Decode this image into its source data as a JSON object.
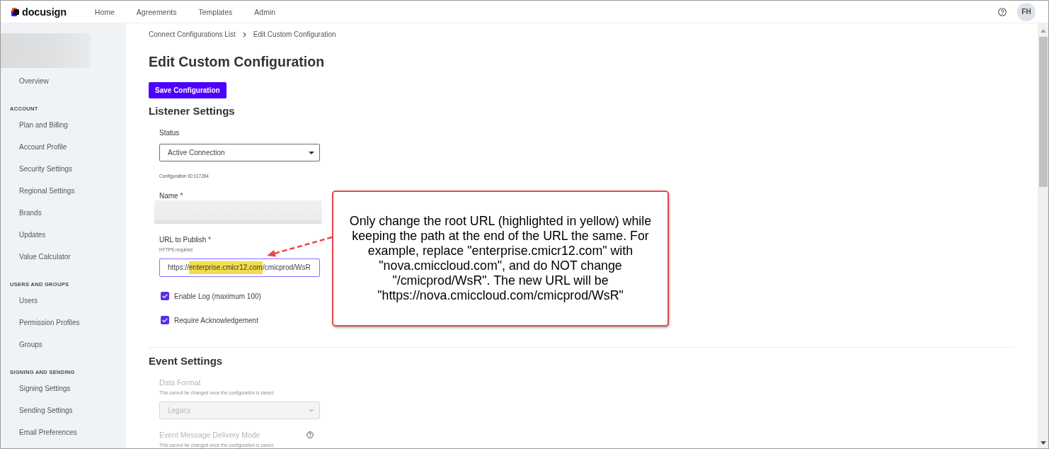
{
  "header": {
    "logo": "docusign",
    "nav": [
      "Home",
      "Agreements",
      "Templates",
      "Admin"
    ],
    "avatar": "FH"
  },
  "sidebar": {
    "overview": "Overview",
    "sections": [
      {
        "heading": "ACCOUNT",
        "items": [
          "Plan and Billing",
          "Account Profile",
          "Security Settings",
          "Regional Settings",
          "Brands",
          "Updates",
          "Value Calculator"
        ]
      },
      {
        "heading": "USERS AND GROUPS",
        "items": [
          "Users",
          "Permission Profiles",
          "Groups"
        ]
      },
      {
        "heading": "SIGNING AND SENDING",
        "items": [
          "Signing Settings",
          "Sending Settings",
          "Email Preferences"
        ]
      }
    ]
  },
  "breadcrumb": [
    "Connect Configurations List",
    "Edit Custom Configuration"
  ],
  "page_title": "Edit Custom Configuration",
  "save_button": "Save Configuration",
  "listener_settings": {
    "heading": "Listener Settings",
    "status": {
      "label": "Status",
      "value": "Active Connection",
      "focused": false
    },
    "configuration_id": "Configuration ID:117264",
    "name": {
      "label": "Name",
      "required_mark": "*"
    },
    "url": {
      "label": "URL to Publish",
      "required_mark": "*",
      "hint": "HTTPS required",
      "focused": true,
      "value": [
        {
          "text": "https://",
          "highlighted": false
        },
        {
          "text": "enterprise.cmicr12.com",
          "highlighted": true
        },
        {
          "text": "/cmicprod/WsR",
          "highlighted": false
        }
      ]
    },
    "options": [
      {
        "label": "Enable Log (maximum 100)",
        "checked": true
      },
      {
        "label": "Require Acknowledgement",
        "checked": true
      }
    ]
  },
  "event_settings": {
    "heading": "Event Settings",
    "fields": [
      {
        "label": "Data Format",
        "hint": "This cannot be changed once the configuration is saved.",
        "disabled": true,
        "help": false,
        "value": "Legacy"
      },
      {
        "label": "Event Message Delivery Mode",
        "hint": "This cannot be changed once the configuration is saved.",
        "disabled": true,
        "help": true
      }
    ]
  },
  "callout": {
    "text": "Only change the root URL (highlighted in yellow) while keeping the path at the end of the URL the same. For example, replace \"enterprise.cmicr12.com\" with \"nova.cmiccloud.com\", and do NOT change \"/cmicprod/WsR\". The new URL will be \"https://nova.cmiccloud.com/cmicprod/WsR\""
  }
}
